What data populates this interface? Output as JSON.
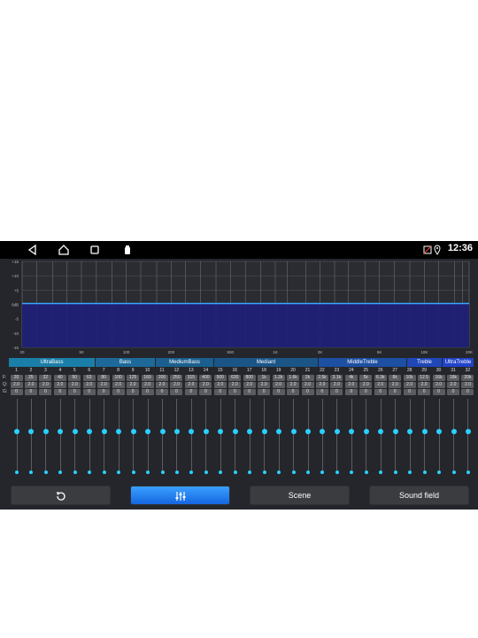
{
  "status_bar": {
    "clock": "12:36"
  },
  "graph": {
    "y_ticks": [
      "+15",
      "+10",
      "+5",
      "0dB",
      "-5",
      "-10",
      "-15"
    ],
    "x_ticks": [
      "20",
      "50",
      "100",
      "200",
      "500",
      "1K",
      "2K",
      "5K",
      "10K",
      "20K"
    ],
    "level_db": 0,
    "fill_color": "#1f1f7a",
    "line_color": "#3aa6ff"
  },
  "bands": [
    {
      "label": "UltraBass",
      "color": "#1b7ea8"
    },
    {
      "label": "Bass",
      "color": "#1d6a9a"
    },
    {
      "label": "MediumBass",
      "color": "#1a5f8f"
    },
    {
      "label": "Mediant",
      "color": "#1b5588"
    },
    {
      "label": "MiddleTreble",
      "color": "#1d4fa2"
    },
    {
      "label": "Treble",
      "color": "#1f47b8"
    },
    {
      "label": "UltraTreble",
      "color": "#2243c9"
    }
  ],
  "row_labels": {
    "freq": "F:",
    "q": "Q:",
    "gain": "G:"
  },
  "channels": [
    {
      "n": "1",
      "f": "20",
      "q": "2.0",
      "g": "0"
    },
    {
      "n": "2",
      "f": "25",
      "q": "2.0",
      "g": "0"
    },
    {
      "n": "3",
      "f": "32",
      "q": "2.0",
      "g": "0"
    },
    {
      "n": "4",
      "f": "40",
      "q": "2.0",
      "g": "0"
    },
    {
      "n": "5",
      "f": "50",
      "q": "2.0",
      "g": "0"
    },
    {
      "n": "6",
      "f": "63",
      "q": "2.0",
      "g": "0"
    },
    {
      "n": "7",
      "f": "80",
      "q": "2.0",
      "g": "0"
    },
    {
      "n": "8",
      "f": "100",
      "q": "2.0",
      "g": "0"
    },
    {
      "n": "9",
      "f": "125",
      "q": "2.0",
      "g": "0"
    },
    {
      "n": "10",
      "f": "160",
      "q": "2.0",
      "g": "0"
    },
    {
      "n": "11",
      "f": "200",
      "q": "2.0",
      "g": "0"
    },
    {
      "n": "12",
      "f": "250",
      "q": "2.0",
      "g": "0"
    },
    {
      "n": "13",
      "f": "315",
      "q": "2.0",
      "g": "0"
    },
    {
      "n": "14",
      "f": "400",
      "q": "2.0",
      "g": "0"
    },
    {
      "n": "15",
      "f": "500",
      "q": "2.0",
      "g": "0"
    },
    {
      "n": "16",
      "f": "630",
      "q": "2.0",
      "g": "0"
    },
    {
      "n": "17",
      "f": "800",
      "q": "2.0",
      "g": "0"
    },
    {
      "n": "18",
      "f": "1k",
      "q": "2.0",
      "g": "0"
    },
    {
      "n": "19",
      "f": "1.2k",
      "q": "2.0",
      "g": "0"
    },
    {
      "n": "20",
      "f": "1.6k",
      "q": "2.0",
      "g": "0"
    },
    {
      "n": "21",
      "f": "2k",
      "q": "2.0",
      "g": "0"
    },
    {
      "n": "22",
      "f": "2.5k",
      "q": "2.0",
      "g": "0"
    },
    {
      "n": "23",
      "f": "3.1k",
      "q": "2.0",
      "g": "0"
    },
    {
      "n": "24",
      "f": "4k",
      "q": "2.0",
      "g": "0"
    },
    {
      "n": "25",
      "f": "5k",
      "q": "2.0",
      "g": "0"
    },
    {
      "n": "26",
      "f": "6.3k",
      "q": "2.0",
      "g": "0"
    },
    {
      "n": "27",
      "f": "8k",
      "q": "2.0",
      "g": "0"
    },
    {
      "n": "28",
      "f": "10k",
      "q": "2.0",
      "g": "0"
    },
    {
      "n": "29",
      "f": "12.5",
      "q": "2.0",
      "g": "0"
    },
    {
      "n": "30",
      "f": "16k",
      "q": "2.0",
      "g": "0"
    },
    {
      "n": "31",
      "f": "18k",
      "q": "2.0",
      "g": "0"
    },
    {
      "n": "32",
      "f": "20k",
      "q": "2.0",
      "g": "0"
    }
  ],
  "buttons": {
    "reset_icon": "reset-icon",
    "eq_icon": "equalizer-icon",
    "scene": "Scene",
    "sound_field": "Sound field"
  },
  "colors": {
    "accent": "#2ad0ff",
    "active_button": "#1e7ef5"
  }
}
